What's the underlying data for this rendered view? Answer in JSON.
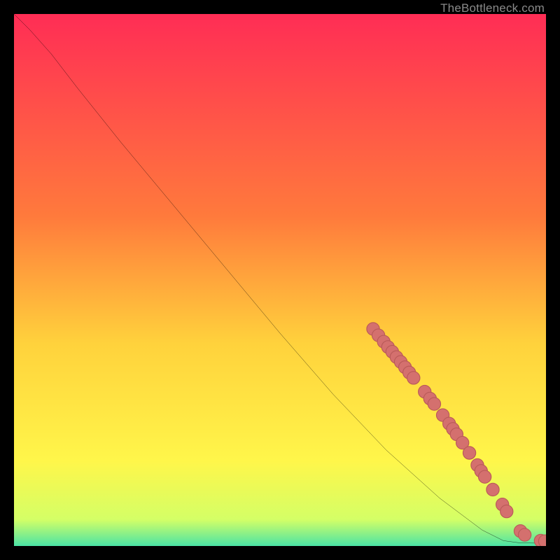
{
  "watermark": "TheBottleneck.com",
  "colors": {
    "gradient_top": "#ff2d55",
    "gradient_mid1": "#ff7a3c",
    "gradient_mid2": "#ffd23c",
    "gradient_mid3": "#fff64a",
    "gradient_bottom1": "#d4ff66",
    "gradient_bottom2": "#4be3a5",
    "curve": "#000000",
    "marker_fill": "#d4706e",
    "marker_stroke": "#b95a58",
    "background": "#000000"
  },
  "chart_data": {
    "type": "line",
    "title": "",
    "xlabel": "",
    "ylabel": "",
    "xlim": [
      0,
      100
    ],
    "ylim": [
      0,
      100
    ],
    "grid": false,
    "legend": false,
    "curve": [
      {
        "x": 0,
        "y": 100
      },
      {
        "x": 3,
        "y": 97
      },
      {
        "x": 7,
        "y": 92.5
      },
      {
        "x": 12,
        "y": 86
      },
      {
        "x": 20,
        "y": 76
      },
      {
        "x": 30,
        "y": 64
      },
      {
        "x": 40,
        "y": 52
      },
      {
        "x": 50,
        "y": 40
      },
      {
        "x": 60,
        "y": 28.5
      },
      {
        "x": 70,
        "y": 18
      },
      {
        "x": 80,
        "y": 9
      },
      {
        "x": 88,
        "y": 3
      },
      {
        "x": 92,
        "y": 1
      },
      {
        "x": 95,
        "y": 0.6
      },
      {
        "x": 100,
        "y": 0.5
      }
    ],
    "markers": [
      {
        "x": 67.5,
        "y": 40.8
      },
      {
        "x": 68.5,
        "y": 39.6
      },
      {
        "x": 69.5,
        "y": 38.4
      },
      {
        "x": 70.3,
        "y": 37.4
      },
      {
        "x": 71.1,
        "y": 36.5
      },
      {
        "x": 71.9,
        "y": 35.5
      },
      {
        "x": 72.7,
        "y": 34.6
      },
      {
        "x": 73.5,
        "y": 33.6
      },
      {
        "x": 74.3,
        "y": 32.6
      },
      {
        "x": 75.1,
        "y": 31.6
      },
      {
        "x": 77.2,
        "y": 29.0
      },
      {
        "x": 78.2,
        "y": 27.7
      },
      {
        "x": 79.0,
        "y": 26.7
      },
      {
        "x": 80.6,
        "y": 24.6
      },
      {
        "x": 81.8,
        "y": 23.0
      },
      {
        "x": 82.5,
        "y": 22.0
      },
      {
        "x": 83.2,
        "y": 21.0
      },
      {
        "x": 84.3,
        "y": 19.4
      },
      {
        "x": 85.6,
        "y": 17.5
      },
      {
        "x": 87.1,
        "y": 15.2
      },
      {
        "x": 87.8,
        "y": 14.1
      },
      {
        "x": 88.5,
        "y": 13.0
      },
      {
        "x": 90.0,
        "y": 10.6
      },
      {
        "x": 91.8,
        "y": 7.8
      },
      {
        "x": 92.6,
        "y": 6.5
      },
      {
        "x": 95.2,
        "y": 2.8
      },
      {
        "x": 96.0,
        "y": 2.1
      },
      {
        "x": 99.0,
        "y": 1.0
      },
      {
        "x": 99.8,
        "y": 0.9
      }
    ],
    "marker_radius": 1.2
  }
}
